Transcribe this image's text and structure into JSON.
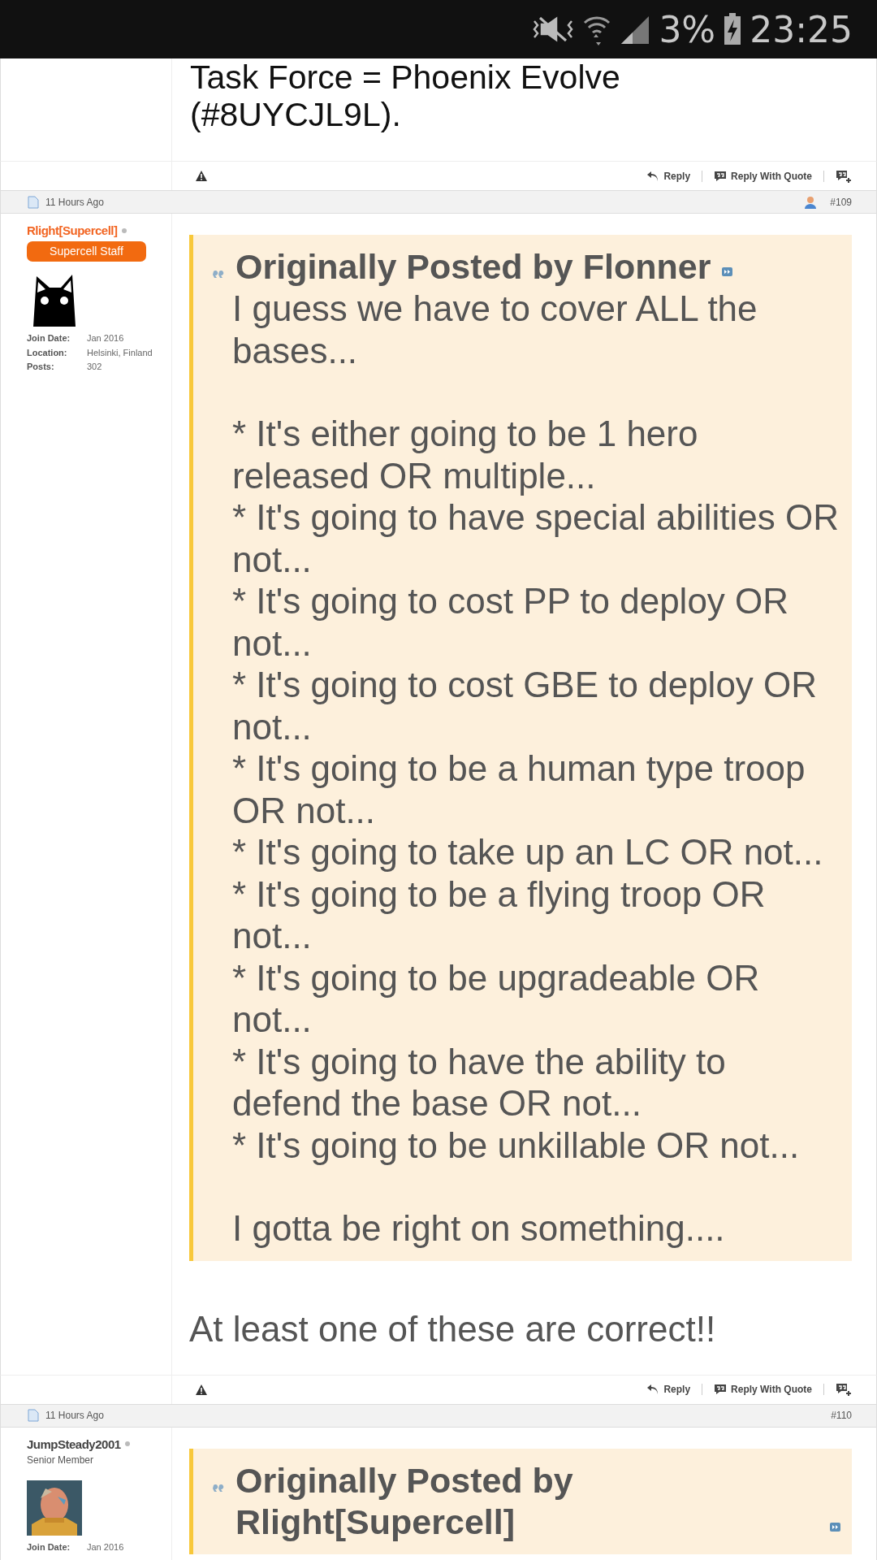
{
  "status_bar": {
    "battery": "3%",
    "time": "23:25"
  },
  "top_post": {
    "body": [
      "Task Force = Phoenix Evolve",
      "(#8UYCJL9L)."
    ],
    "footer": {
      "reply": "Reply",
      "reply_with_quote": "Reply With Quote"
    }
  },
  "posts": [
    {
      "header": {
        "time": "11 Hours Ago",
        "number": "#109",
        "profile_icon": true
      },
      "author": {
        "kind": "staff",
        "name": "Rlight[Supercell]",
        "online": false,
        "title": "Supercell Staff",
        "avatar": {
          "kind": "cat"
        },
        "info": [
          {
            "label": "Join Date:",
            "value": "Jan 2016"
          },
          {
            "label": "Location:",
            "value": "Helsinki, Finland"
          },
          {
            "label": "Posts:",
            "value": "302"
          }
        ]
      },
      "quote": {
        "heading": "Originally Posted by Flonner",
        "paragraphs": [
          [
            "I guess we have to cover ALL the bases..."
          ],
          [
            "* It's either going to be 1 hero released OR multiple...",
            "* It's going to have special abilities OR not...",
            "* It's going to cost PP to deploy OR not...",
            "* It's going to cost GBE to deploy OR not...",
            "* It's going to be a human type troop OR not...",
            "* It's going to take up an LC OR not...",
            "* It's going to be a flying troop OR not...",
            "* It's going to be upgradeable OR not...",
            "* It's going to have the ability to defend the base OR not...",
            "* It's going to be unkillable OR not..."
          ],
          [
            "I gotta be right on something...."
          ]
        ]
      },
      "message": "At least one of these are correct!!",
      "footer": {
        "reply": "Reply",
        "reply_with_quote": "Reply With Quote"
      }
    },
    {
      "header": {
        "time": "11 Hours Ago",
        "number": "#110",
        "profile_icon": false
      },
      "author": {
        "kind": "member",
        "name": "JumpSteady2001",
        "online": false,
        "title": "Senior Member",
        "info": [
          {
            "label": "Join Date:",
            "value": "Jan 2016"
          }
        ]
      },
      "quote": {
        "heading": "Originally Posted by Rlight[Supercell]"
      }
    }
  ]
}
